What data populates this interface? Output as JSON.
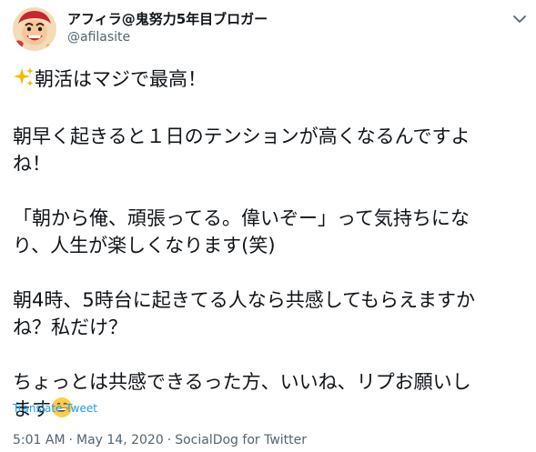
{
  "author": {
    "display_name": "アフィラ@鬼努力5年目ブロガー",
    "handle": "@afilasite"
  },
  "icons": {
    "avatar": "cartoon-face-avatar",
    "more": "chevron-down-icon",
    "sparkle": "sparkles-icon",
    "grin": "grinning-face-icon"
  },
  "tweet": {
    "lines": [
      "朝活はマジで最高！",
      "",
      "朝早く起きると１日のテンションが高くなるんですよ",
      "ね！",
      "",
      "「朝から俺、頑張ってる。偉いぞー」って気持ちにな",
      "り、人生が楽しくなります(笑)",
      "",
      "朝4時、5時台に起きてる人なら共感してもらえますか",
      "ね？私だけ？",
      "",
      "ちょっとは共感できるった方、いいね、リプお願いし",
      "ます"
    ]
  },
  "translate_label": "Translate Tweet",
  "meta": {
    "time": "5:01 AM",
    "separator1": "·",
    "date": "May 14, 2020",
    "separator2": "·",
    "source": "SocialDog for Twitter"
  },
  "colors": {
    "link": "#1d9bf0",
    "secondary_text": "#536471",
    "primary_text": "#0f1419"
  }
}
